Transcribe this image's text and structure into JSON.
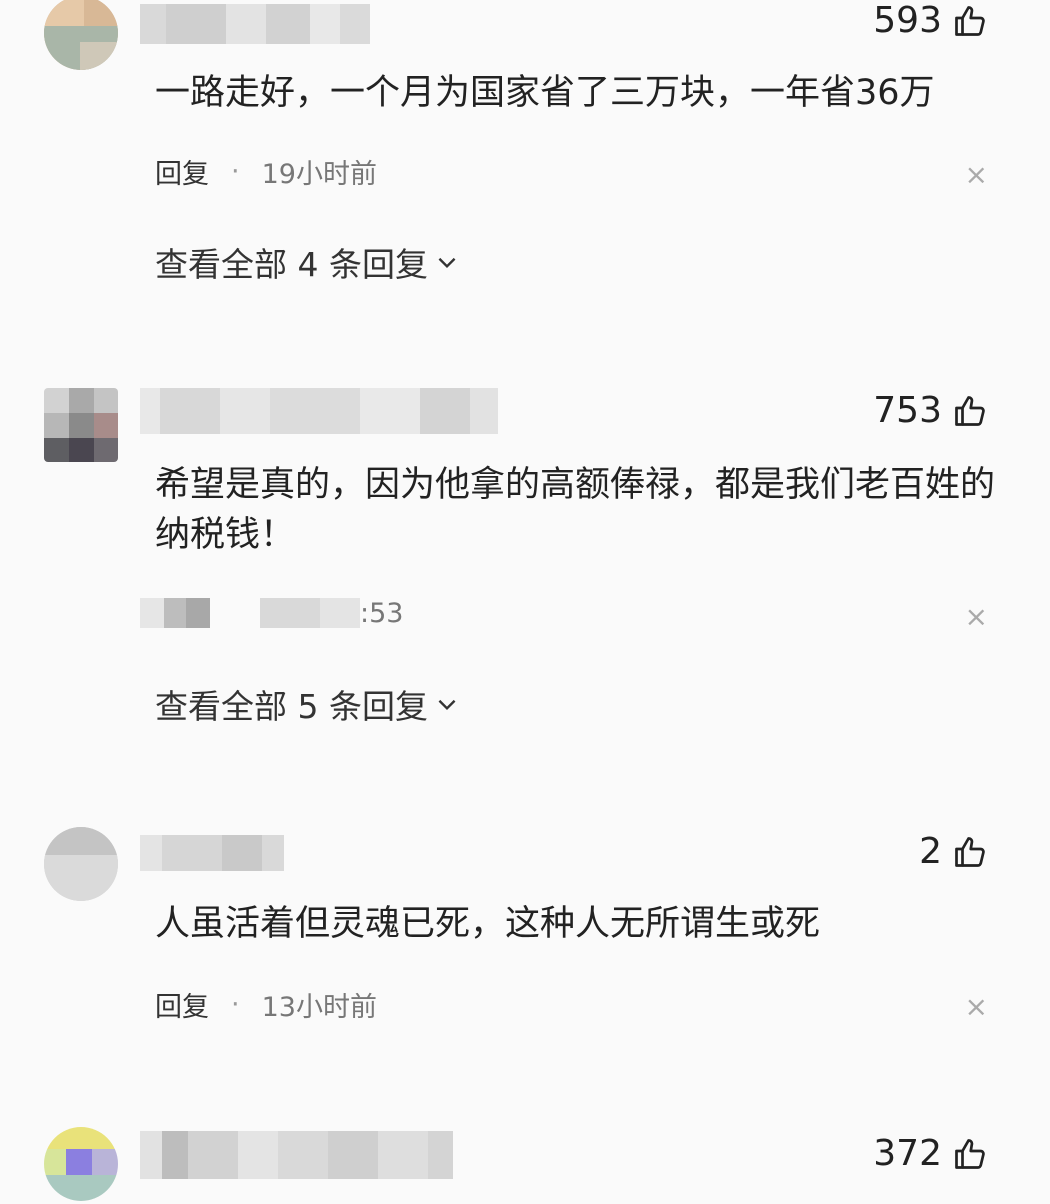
{
  "comments": [
    {
      "likes": "593",
      "text": "一路走好，一个月为国家省了三万块，一年省36万",
      "reply_label": "回复",
      "time": "19小时前",
      "close": "×",
      "view_all": "查看全部 4 条回复"
    },
    {
      "likes": "753",
      "text": "希望是真的，因为他拿的高额俸禄，都是我们老百姓的纳税钱！",
      "time_partial": ":53",
      "close": "×",
      "view_all": "查看全部 5 条回复"
    },
    {
      "likes": "2",
      "text": "人虽活着但灵魂已死，这种人无所谓生或死",
      "reply_label": "回复",
      "time": "13小时前",
      "close": "×"
    },
    {
      "likes": "372"
    }
  ],
  "icons": {
    "like": "thumbs-up-icon",
    "chevron": "chevron-down-icon",
    "close": "close-icon"
  }
}
